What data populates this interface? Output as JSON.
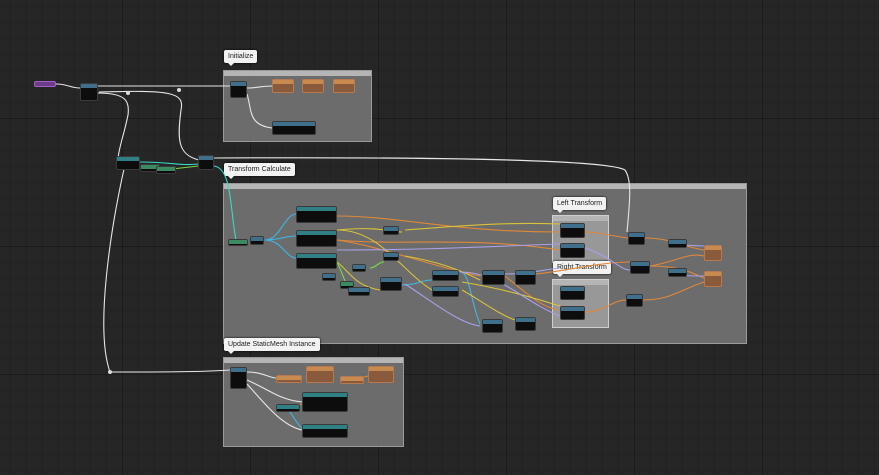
{
  "blueprint": {
    "comments": {
      "initialize": "Initialize",
      "transform_calculate": "Transform Calculate",
      "left_transform": "Left Transform",
      "right_transform": "Right Transform",
      "update_staticmesh_instance": "Update StaticMesh Instance"
    }
  },
  "colors": {
    "canvas": "#262626",
    "comment_box": "#7d7d7d",
    "exec_wire": "#e6e6e6",
    "transform_wire": "#e0883a",
    "vector_wire": "#d8c23a",
    "struct_wire": "#3ad8c8",
    "object_wire": "#3fb6e8",
    "float_wire": "#7ad84a"
  }
}
